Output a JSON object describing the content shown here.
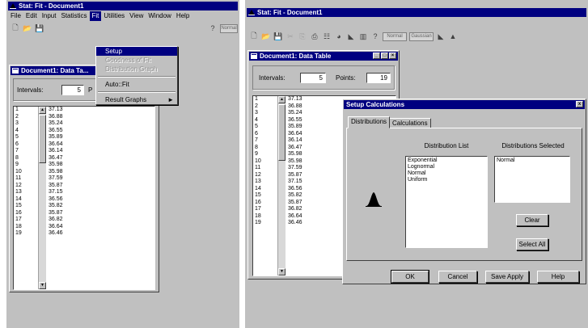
{
  "left_window": {
    "app_title": "Stat: Fit - Document1",
    "menus": [
      "File",
      "Edit",
      "Input",
      "Statistics",
      "Fit",
      "Utilities",
      "View",
      "Window",
      "Help"
    ],
    "toolbar_box": "Normal",
    "doc_title": "Document1: Data Ta...",
    "intervals_label": "Intervals:",
    "intervals_value": "5",
    "points_label_partial": "P",
    "row_numbers": [
      "1",
      "2",
      "3",
      "4",
      "5",
      "6",
      "7",
      "8",
      "9",
      "10",
      "11",
      "12",
      "13",
      "14",
      "15",
      "16",
      "17",
      "18",
      "19"
    ],
    "values": [
      "37.13",
      "36.88",
      "35.24",
      "36.55",
      "35.89",
      "36.64",
      "36.14",
      "36.47",
      "35.98",
      "35.98",
      "37.59",
      "35.87",
      "37.15",
      "36.56",
      "35.82",
      "35.87",
      "36.82",
      "36.64",
      "36.46"
    ],
    "fit_menu": {
      "items": [
        {
          "label": "Setup",
          "state": "selected"
        },
        {
          "label": "Goodness of Fit",
          "state": "disabled"
        },
        {
          "label": "Distribution Graph",
          "state": "disabled"
        },
        {
          "label": "Auto::Fit",
          "state": "normal"
        },
        {
          "label": "Result Graphs",
          "state": "normal",
          "submenu": "►"
        }
      ]
    }
  },
  "right_window": {
    "app_title": "Stat: Fit - Document1",
    "toolbar_box1": "Normal",
    "toolbar_box2": "Gaussian",
    "doc_title": "Document1: Data Table",
    "intervals_label": "Intervals:",
    "intervals_value": "5",
    "points_label": "Points:",
    "points_value": "19",
    "row_numbers": [
      "1",
      "2",
      "3",
      "4",
      "5",
      "6",
      "7",
      "8",
      "9",
      "10",
      "11",
      "12",
      "13",
      "14",
      "15",
      "16",
      "17",
      "18",
      "19"
    ],
    "values": [
      "37.13",
      "36.88",
      "35.24",
      "36.55",
      "35.89",
      "36.64",
      "36.14",
      "36.47",
      "35.98",
      "35.98",
      "37.59",
      "35.87",
      "37.15",
      "36.56",
      "35.82",
      "35.87",
      "36.82",
      "36.64",
      "36.46"
    ]
  },
  "dialog": {
    "title": "Setup Calculations",
    "close": "x",
    "tabs": [
      "Distributions",
      "Calculations"
    ],
    "dist_list_header": "Distribution List",
    "dist_list": [
      "Exponential",
      "Lognormal",
      "Normal",
      "Uniform"
    ],
    "selected_header": "Distributions Selected",
    "selected_list": [
      "Normal"
    ],
    "clear_btn": "Clear",
    "select_all_btn": "Select All",
    "ok_btn": "OK",
    "cancel_btn": "Cancel",
    "save_btn": "Save Apply",
    "help_btn": "Help"
  }
}
